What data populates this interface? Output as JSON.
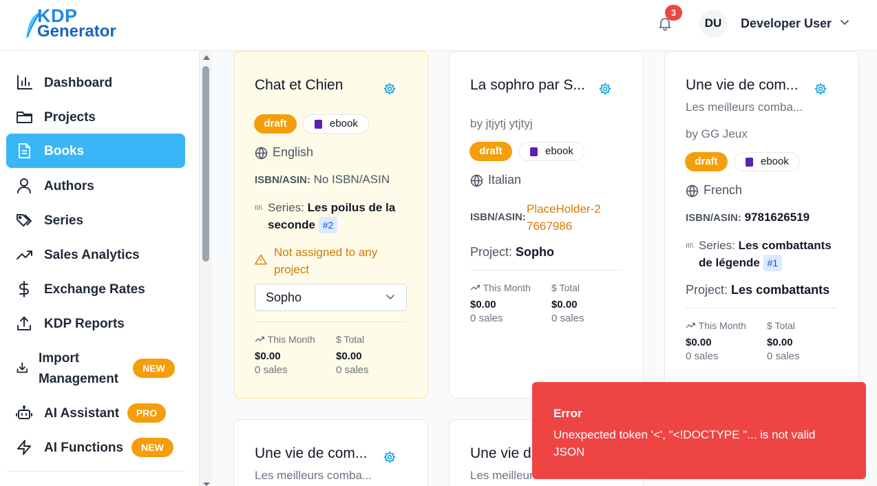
{
  "header": {
    "logo_line1": "KDP",
    "logo_line2": "Generator",
    "notification_count": "3",
    "avatar_initials": "DU",
    "user_name": "Developer User"
  },
  "sidebar": {
    "items": [
      {
        "label": "Dashboard",
        "icon": "bar-chart-icon"
      },
      {
        "label": "Projects",
        "icon": "folder-icon"
      },
      {
        "label": "Books",
        "icon": "document-icon",
        "active": true
      },
      {
        "label": "Authors",
        "icon": "user-icon"
      },
      {
        "label": "Series",
        "icon": "tags-icon"
      },
      {
        "label": "Sales Analytics",
        "icon": "trending-up-icon"
      },
      {
        "label": "Exchange Rates",
        "icon": "dollar-icon"
      },
      {
        "label": "KDP Reports",
        "icon": "upload-icon"
      },
      {
        "label_line1": "Import",
        "label_line2": "Management",
        "icon": "download-icon",
        "badge": "NEW"
      },
      {
        "label": "AI Assistant",
        "icon": "robot-icon",
        "badge": "PRO"
      },
      {
        "label": "AI Functions",
        "icon": "lightning-icon",
        "badge": "NEW"
      }
    ]
  },
  "cards": [
    {
      "title": "Chat et Chien",
      "status": "draft",
      "format": "ebook",
      "language": "English",
      "isbn_label": "ISBN/ASIN:",
      "isbn_value": "No ISBN/ASIN",
      "series_label": "Series:",
      "series_name": "Les poilus de la seconde",
      "series_number": "#2",
      "warning": "Not assigned to any project",
      "project_select": "Sopho",
      "this_month_label": "This Month",
      "total_label": "Total",
      "this_month_value": "$0.00",
      "this_month_sales": "0 sales",
      "total_value": "$0.00",
      "total_sales": "0 sales"
    },
    {
      "title": "La sophro par S...",
      "author": "by jtjytj ytjtyj",
      "status": "draft",
      "format": "ebook",
      "language": "Italian",
      "isbn_label": "ISBN/ASIN:",
      "isbn_value": "PlaceHolder-27667986",
      "project_label": "Project:",
      "project_name": "Sopho",
      "this_month_label": "This Month",
      "total_label": "Total",
      "this_month_value": "$0.00",
      "this_month_sales": "0 sales",
      "total_value": "$0.00",
      "total_sales": "0 sales"
    },
    {
      "title": "Une vie de com...",
      "subtitle": "Les meilleurs comba...",
      "author": "by GG Jeux",
      "status": "draft",
      "format": "ebook",
      "language": "French",
      "isbn_label": "ISBN/ASIN:",
      "isbn_value": "9781626519",
      "series_label": "Series:",
      "series_name": "Les combattants de légende",
      "series_number": "#1",
      "project_label": "Project:",
      "project_name": "Les combattants",
      "this_month_label": "This Month",
      "total_label": "Total",
      "this_month_value": "$0.00",
      "this_month_sales": "0 sales",
      "total_value": "$0.00",
      "total_sales": "0 sales"
    },
    {
      "title": "Une vie de com...",
      "subtitle": "Les meilleurs comba..."
    },
    {
      "title": "Une vie d",
      "subtitle": "Les meilleur"
    }
  ],
  "toast": {
    "title": "Error",
    "message": "Unexpected token '<', \"<!DOCTYPE \"... is not valid JSON"
  },
  "colors": {
    "accent": "#38b6f8",
    "draft": "#f59e0b",
    "error": "#ef4444",
    "warning": "#d97706"
  }
}
